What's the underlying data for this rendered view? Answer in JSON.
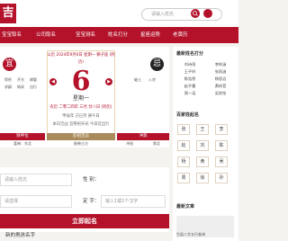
{
  "header": {
    "logo_char": "吉",
    "search_placeholder": "请输入姓氏"
  },
  "nav": [
    "宝宝取名",
    "公司取名",
    "宝宝测名",
    "姓名打分",
    "星座运势",
    "老黄历"
  ],
  "calendar": {
    "left_badge": "宜",
    "right_badge": "忌",
    "left_cells": [
      "祭祀",
      "开光",
      "嫁娶",
      "求嗣",
      "纳采",
      "出行"
    ],
    "right_cells": [
      "破土",
      "入宅"
    ],
    "date_line": "公历 2024年9月6日 星期一 狮子座 (阴历)",
    "day_number": "6",
    "weekday": "星期一",
    "lunar_line": "农历 二零二四年 三月 廿八日 (阴历)",
    "solar_term": "甲辰年 己巳月 庚午日",
    "note": "本日吉凶 宜祭祀开光 今日宜出行",
    "left_bottom_title": "财神位",
    "right_bottom_title": "冲煞",
    "left_bottom": [
      "喜神：东北",
      "福神：东南",
      "财神：正东"
    ],
    "right_bottom": [
      "冲鼠",
      "煞北"
    ],
    "mid_bottom": [
      "彭祖百忌",
      "胎神占方"
    ],
    "prev_label": "◀",
    "next_label": "▶"
  },
  "side": {
    "title1": "最新姓名打分",
    "grid": [
      "刘诗雨",
      "李梓涵",
      "王子轩",
      "张雨涵",
      "陈浩然",
      "杨思远",
      "赵子墨",
      "黄梓萱",
      "周一诺",
      "吴欣怡"
    ],
    "title2": "百家姓起名",
    "chips": [
      "张",
      "王",
      "李",
      "赵",
      "刘",
      "陈",
      "杨",
      "黄",
      "吴",
      "周",
      "徐",
      "孙"
    ],
    "title3": "最新文章",
    "footer_text": "生辰八字五行查询"
  },
  "form": {
    "surname_placeholder": "请输入姓氏",
    "gender_label": "性 别：",
    "date_placeholder": "请选择",
    "fixed_label": "定 字：",
    "fixed_placeholder": "输入1或2个汉字",
    "submit_label": "立即起名",
    "bottom_text": "新的男孩名字"
  }
}
